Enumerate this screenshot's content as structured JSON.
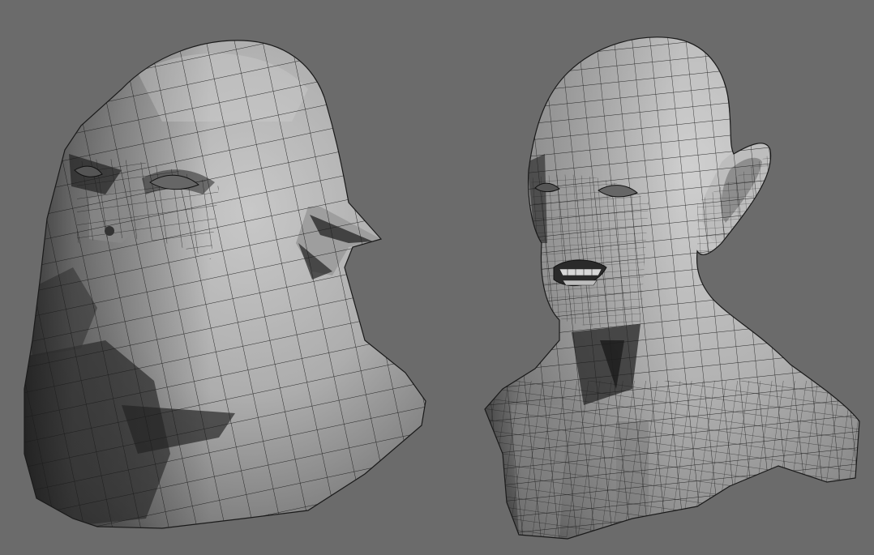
{
  "scene": {
    "background_color": "#6b6b6b",
    "wire_color": "#1a1a1a",
    "shade_light": "#c4c4c4",
    "shade_mid": "#9a9a9a",
    "shade_dark": "#555555",
    "shade_black": "#222222"
  },
  "models": [
    {
      "name": "ogre-head-wireframe"
    },
    {
      "name": "human-bust-wireframe"
    }
  ]
}
